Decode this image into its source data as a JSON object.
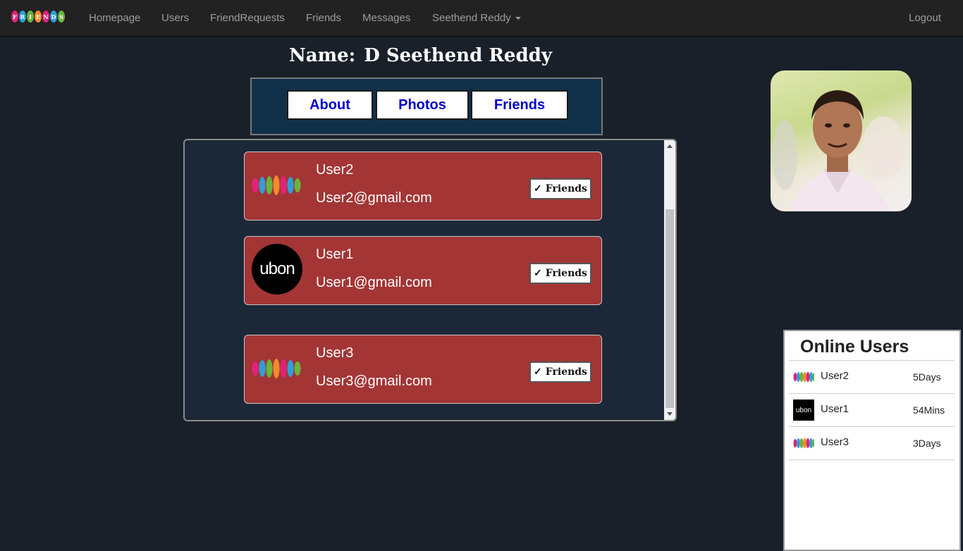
{
  "navbar": {
    "brand_letters": [
      "F",
      "R",
      "I",
      "E",
      "N",
      "D",
      "S"
    ],
    "brand_colors": [
      "#e2227a",
      "#2d9fd9",
      "#6cb33f",
      "#f28c28",
      "#e2227a",
      "#2d9fd9",
      "#6cb33f"
    ],
    "items": [
      {
        "label": "Homepage"
      },
      {
        "label": "Users"
      },
      {
        "label": "FriendRequests"
      },
      {
        "label": "Friends"
      },
      {
        "label": "Messages"
      },
      {
        "label": "Seethend Reddy"
      }
    ],
    "logout_label": "Logout"
  },
  "profile": {
    "name_label": "Name:",
    "name_value": "D Seethend Reddy"
  },
  "tabs": [
    {
      "label": "About"
    },
    {
      "label": "Photos"
    },
    {
      "label": "Friends"
    }
  ],
  "friends_list": [
    {
      "name": "User2",
      "email": "User2@gmail.com",
      "avatar": "friends-logo",
      "status_label": "Friends",
      "status_icon": "checkmark"
    },
    {
      "name": "User1",
      "email": "User1@gmail.com",
      "avatar": "ubon-logo",
      "avatar_text": "ubon",
      "status_label": "Friends",
      "status_icon": "checkmark"
    },
    {
      "name": "User3",
      "email": "User3@gmail.com",
      "avatar": "friends-logo",
      "status_label": "Friends",
      "status_icon": "checkmark"
    }
  ],
  "online_users": {
    "title": "Online Users",
    "users": [
      {
        "name": "User2",
        "time": "5Days",
        "avatar": "friends-logo"
      },
      {
        "name": "User1",
        "time": "54Mins",
        "avatar": "ubon-logo",
        "avatar_text": "ubon"
      },
      {
        "name": "User3",
        "time": "3Days",
        "avatar": "friends-logo"
      }
    ]
  },
  "colors": {
    "page_bg": "#19202a",
    "navbar_bg": "#222222",
    "tabs_box_bg": "#10304a",
    "tab_text": "#0000cc",
    "card_bg": "#a33535"
  }
}
